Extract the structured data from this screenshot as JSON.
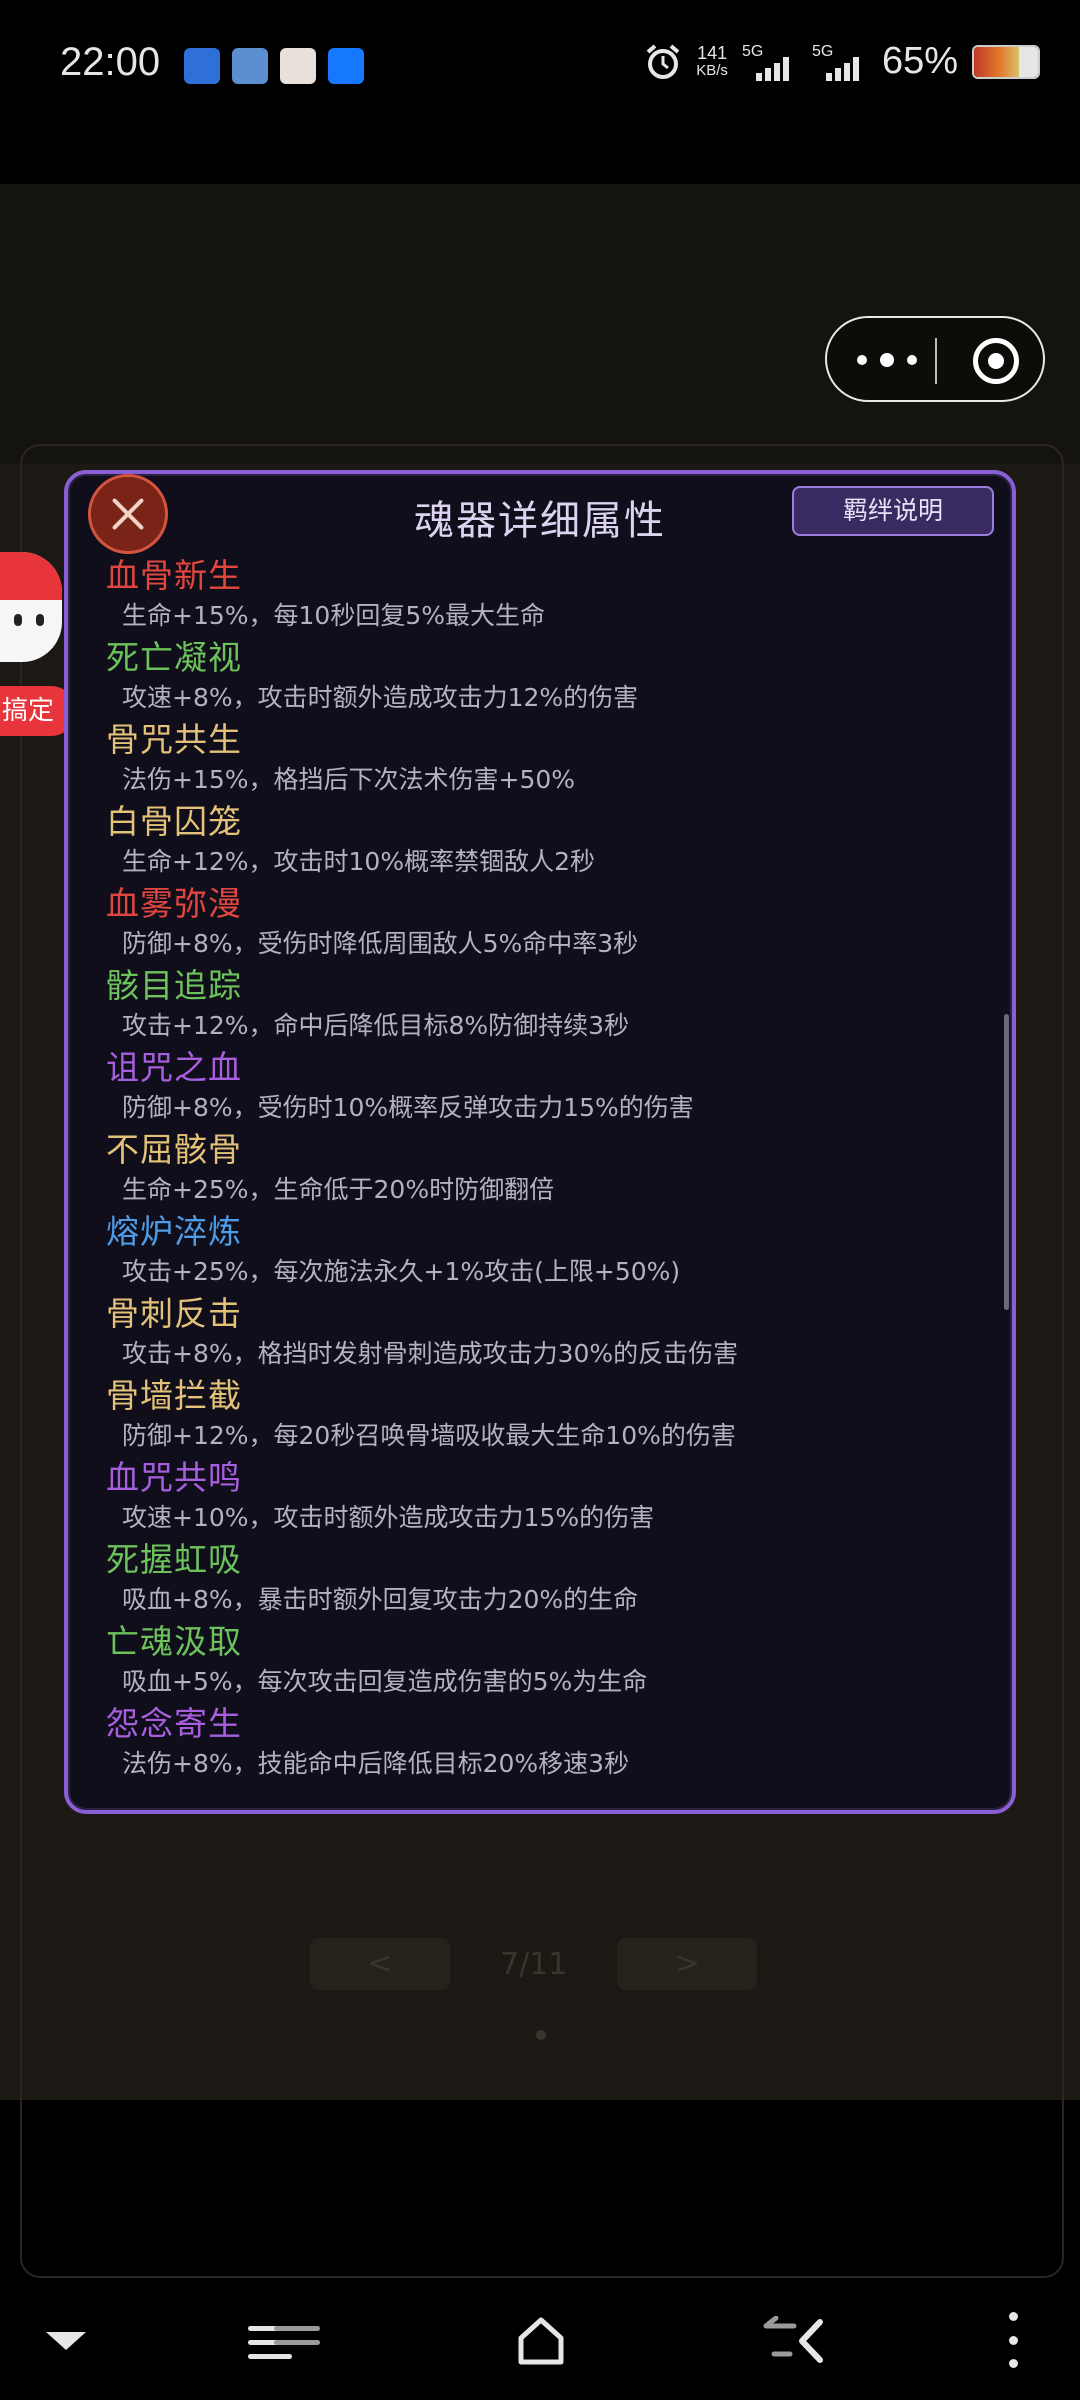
{
  "status_bar": {
    "time": "22:00",
    "net_speed_value": "141",
    "net_speed_unit": "KB/s",
    "sim1_label": "5G",
    "sim2_label": "5G",
    "battery_percent": "65%",
    "notification_icons": [
      "app-icon-blue",
      "app-icon-landscape",
      "app-icon-avatar",
      "alipay-icon"
    ]
  },
  "background": {
    "pager_prev": "<",
    "pager_text": "7/11",
    "pager_next": ">"
  },
  "float": {
    "label": "搞定"
  },
  "dialog": {
    "title": "魂器详细属性",
    "bond_button": "羁绊说明",
    "items": [
      {
        "name": "血骨新生",
        "desc": "生命+15%，每10秒回复5%最大生命",
        "color": "#e2473f"
      },
      {
        "name": "死亡凝视",
        "desc": "攻速+8%，攻击时额外造成攻击力12%的伤害",
        "color": "#6cc25b"
      },
      {
        "name": "骨咒共生",
        "desc": "法伤+15%，格挡后下次法术伤害+50%",
        "color": "#e4c179"
      },
      {
        "name": "白骨囚笼",
        "desc": "生命+12%，攻击时10%概率禁锢敌人2秒",
        "color": "#e4c179"
      },
      {
        "name": "血雾弥漫",
        "desc": "防御+8%，受伤时降低周围敌人5%命中率3秒",
        "color": "#e2473f"
      },
      {
        "name": "骸目追踪",
        "desc": "攻击+12%，命中后降低目标8%防御持续3秒",
        "color": "#6cc25b"
      },
      {
        "name": "诅咒之血",
        "desc": "防御+8%，受伤时10%概率反弹攻击力15%的伤害",
        "color": "#a75fe0"
      },
      {
        "name": "不屈骸骨",
        "desc": "生命+25%，生命低于20%时防御翻倍",
        "color": "#e4c179"
      },
      {
        "name": "熔炉淬炼",
        "desc": "攻击+25%，每次施法永久+1%攻击(上限+50%)",
        "color": "#4e9be6"
      },
      {
        "name": "骨刺反击",
        "desc": "攻击+8%，格挡时发射骨刺造成攻击力30%的反击伤害",
        "color": "#e4c179"
      },
      {
        "name": "骨墙拦截",
        "desc": "防御+12%，每20秒召唤骨墙吸收最大生命10%的伤害",
        "color": "#e4c179"
      },
      {
        "name": "血咒共鸣",
        "desc": "攻速+10%，攻击时额外造成攻击力15%的伤害",
        "color": "#a75fe0"
      },
      {
        "name": "死握虹吸",
        "desc": "吸血+8%，暴击时额外回复攻击力20%的生命",
        "color": "#6cc25b"
      },
      {
        "name": "亡魂汲取",
        "desc": "吸血+5%，每次攻击回复造成伤害的5%为生命",
        "color": "#6cc25b"
      },
      {
        "name": "怨念寄生",
        "desc": "法伤+8%，技能命中后降低目标20%移速3秒",
        "color": "#a75fe0"
      }
    ]
  },
  "nav_bar": {
    "icons": [
      "chevron-down-icon",
      "menu-icon",
      "home-icon",
      "back-icon",
      "kebab-icon"
    ]
  }
}
